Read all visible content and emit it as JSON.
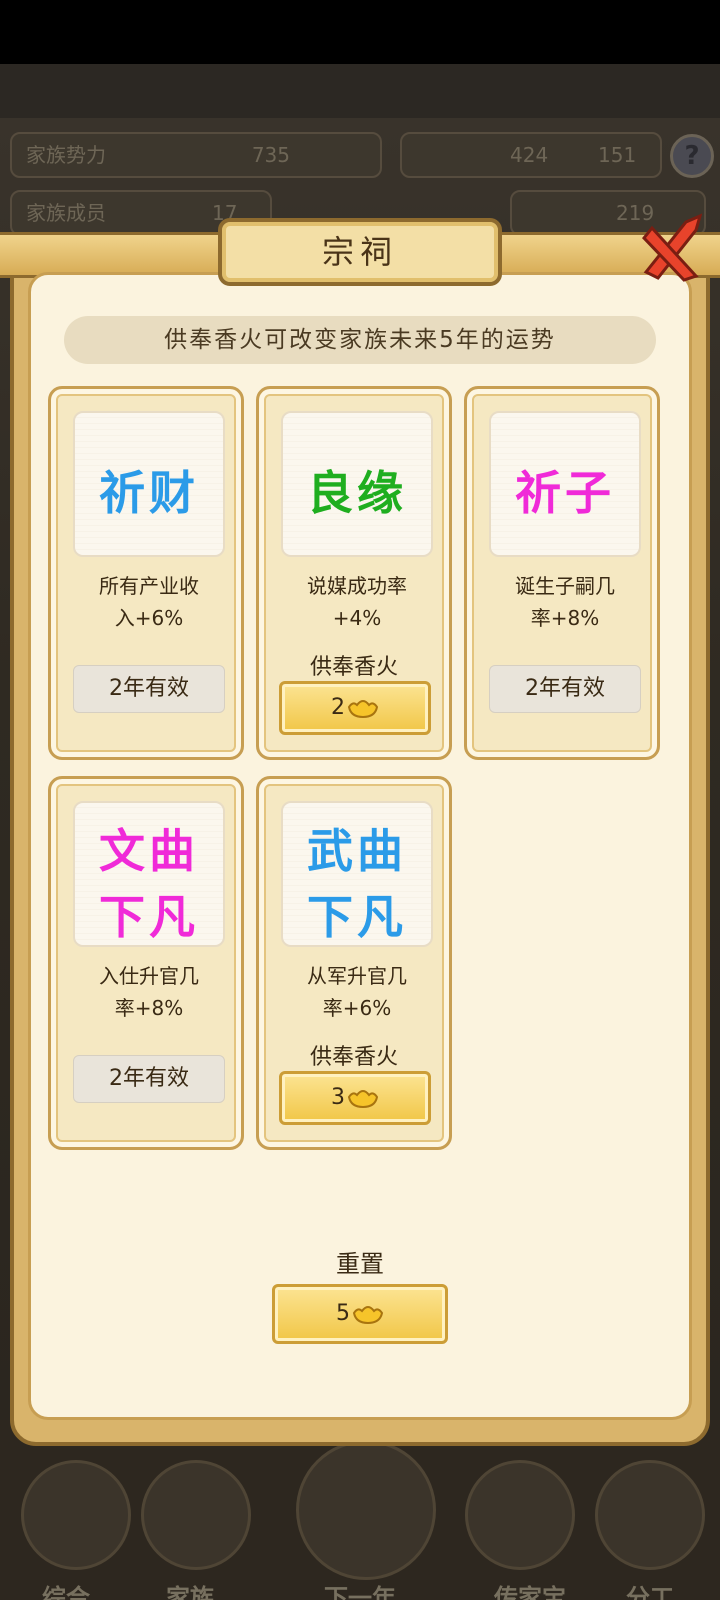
{
  "background": {
    "stats": {
      "family_power_label": "家族势力",
      "family_power_value": "735",
      "members_label": "家族成员",
      "members_value": "17",
      "resource_a": "424",
      "resource_b": "151",
      "gold": "219"
    },
    "nav": {
      "items": [
        {
          "label": "综合"
        },
        {
          "label": "家族"
        },
        {
          "label": "下一年"
        },
        {
          "label": "传家宝"
        },
        {
          "label": "分工"
        }
      ]
    }
  },
  "modal": {
    "title": "宗祠",
    "subtitle": "供奉香火可改变家族未来5年的运势",
    "cards": [
      {
        "name": "祈财",
        "name_color": "#2b9be8",
        "desc_line1": "所有产业收",
        "desc_line2": "入+6%",
        "status": "2年有效"
      },
      {
        "name": "良缘",
        "name_color": "#1fae1f",
        "desc_line1": "说媒成功率",
        "desc_line2": "+4%",
        "action_label": "供奉香火",
        "cost": "2"
      },
      {
        "name": "祈子",
        "name_color": "#f02ad8",
        "desc_line1": "诞生子嗣几",
        "desc_line2": "率+8%",
        "status": "2年有效"
      },
      {
        "name_line1": "文曲",
        "name_line2": "下凡",
        "name_color": "#f02ad8",
        "desc_line1": "入仕升官几",
        "desc_line2": "率+8%",
        "status": "2年有效"
      },
      {
        "name_line1": "武曲",
        "name_line2": "下凡",
        "name_color": "#2b9be8",
        "desc_line1": "从军升官几",
        "desc_line2": "率+6%",
        "action_label": "供奉香火",
        "cost": "3"
      }
    ],
    "reset": {
      "label": "重置",
      "cost": "5"
    }
  },
  "colors": {
    "gold": "#f1c646",
    "frame": "#8d6a2e",
    "panel": "#fbf3de"
  },
  "icons": [
    "gold-ingot-icon",
    "close-icon",
    "help-icon"
  ]
}
